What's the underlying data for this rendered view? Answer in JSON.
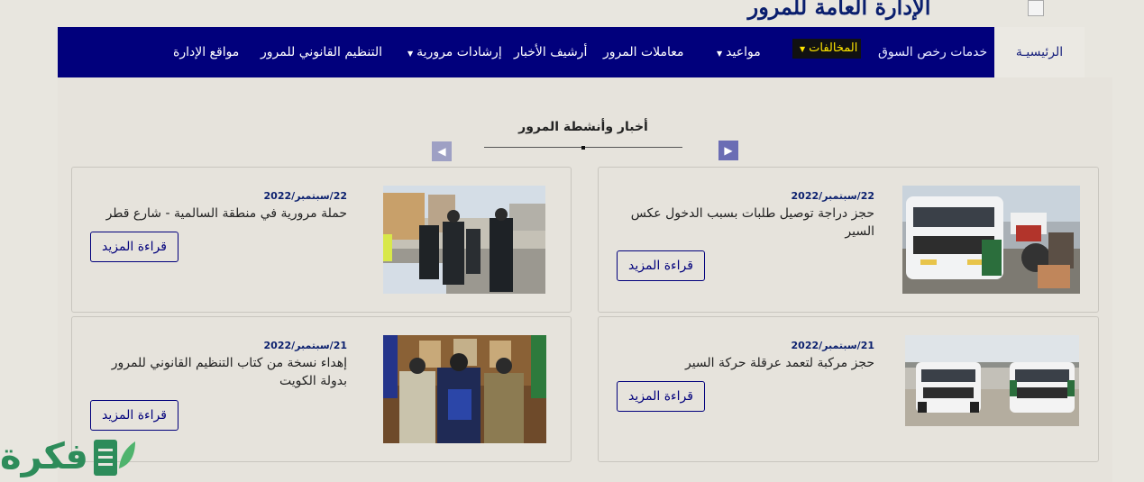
{
  "header": {
    "site_title": "الإدارة العامة للمرور",
    "logo_alt": "logo"
  },
  "nav": {
    "home": "الرئيسيـة",
    "market_licenses": "خدمات رخص السوق",
    "violations": "المخالفات",
    "appointments": "مواعيد",
    "traffic_transactions": "معاملات المرور",
    "news_archive": "أرشيف الأخبار",
    "traffic_guidance": "إرشادات مرورية",
    "legal_regulation": "التنظيم القانوني للمرور",
    "department_sites": "مواقع الإدارة"
  },
  "section": {
    "title": "أخبار وأنشطة المرور",
    "prev_icon": "chevron-left-icon",
    "next_icon": "chevron-right-icon"
  },
  "news": [
    {
      "date": "22/سبتمبر/2022",
      "headline": "حجز دراجة توصيل طلبات بسبب الدخول عكس السير",
      "more": "قراءة المزيد",
      "image": "police-vehicle-motorbike-photo"
    },
    {
      "date": "22/سبتمبر/2022",
      "headline": "حملة مرورية في منطقة السالمية - شارع قطر",
      "more": "قراءة المزيد",
      "image": "traffic-officers-campaign-photo"
    },
    {
      "date": "21/سبتمبر/2022",
      "headline": "حجز مركبة لتعمد عرقلة حركة السير",
      "more": "قراءة المزيد",
      "image": "two-police-suvs-photo"
    },
    {
      "date": "21/سبتمبر/2022",
      "headline": "إهداء نسخة من كتاب التنظيم القانوني للمرور بدولة الكويت",
      "more": "قراءة المزيد",
      "image": "officers-book-handover-photo"
    }
  ],
  "watermark": {
    "text": "فكرة"
  },
  "colors": {
    "nav_bg": "#01007c",
    "accent": "#0a1f6e",
    "violations_text": "#ffe600",
    "page_bg": "#e8e6df",
    "watermark": "#2d8c5a"
  }
}
